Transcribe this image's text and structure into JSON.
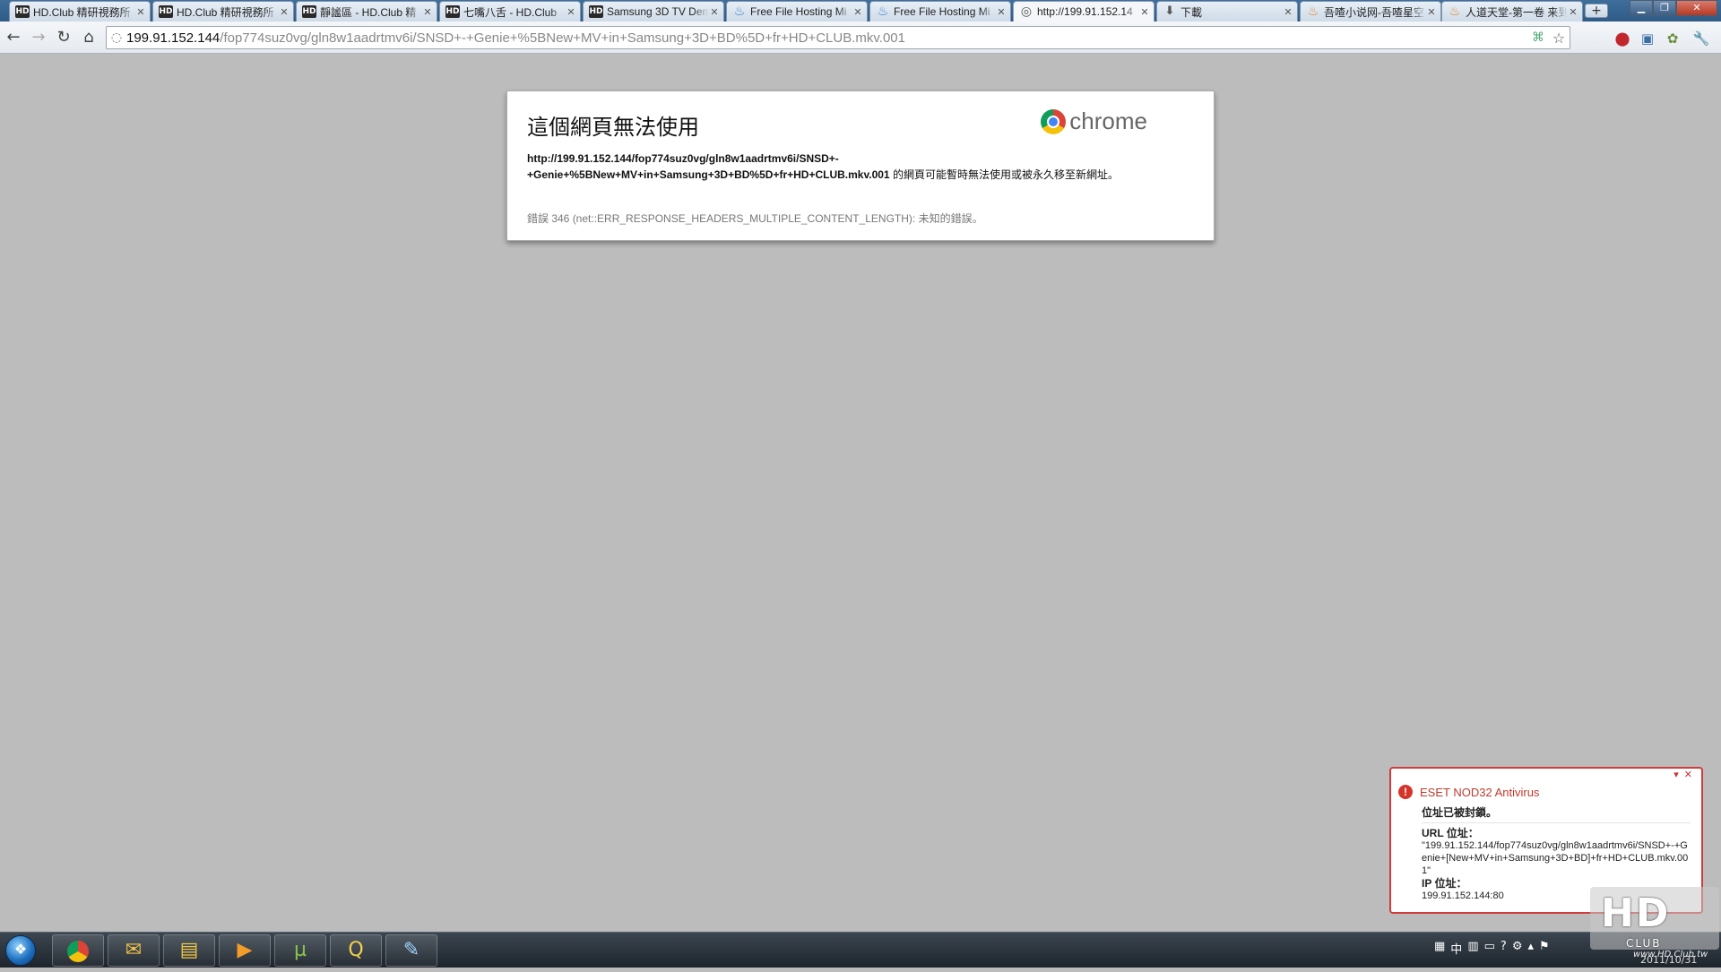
{
  "tabs": [
    {
      "label": "HD.Club 精研視務所",
      "favicon": "hd-club-icon",
      "active": false
    },
    {
      "label": "HD.Club 精研視務所",
      "favicon": "hd-club-icon",
      "active": false
    },
    {
      "label": "靜謐區 - HD.Club 精",
      "favicon": "hd-club-icon",
      "active": false
    },
    {
      "label": "七嘴八舌 - HD.Club",
      "favicon": "hd-club-icon",
      "active": false
    },
    {
      "label": "Samsung 3D TV Dem",
      "favicon": "hd-club-icon",
      "active": false
    },
    {
      "label": "Free File Hosting Mi",
      "favicon": "file-hosting-icon",
      "active": false
    },
    {
      "label": "Free File Hosting Mi",
      "favicon": "file-hosting-icon",
      "active": false
    },
    {
      "label": "http://199.91.152.14",
      "favicon": "globe-icon",
      "active": true
    },
    {
      "label": "下載",
      "favicon": "download-icon",
      "active": false
    },
    {
      "label": "吾喳小说网-吾喳星空",
      "favicon": "novel-site-icon",
      "active": false
    },
    {
      "label": "人道天堂-第一卷 来到",
      "favicon": "novel-site-icon",
      "active": false
    }
  ],
  "address_bar": {
    "host": "199.91.152.144",
    "path": "/fop774suz0vg/gln8w1aadrtmv6i/SNSD+-+Genie+%5BNew+MV+in+Samsung+3D+BD%5D+fr+HD+CLUB.mkv.001"
  },
  "error_page": {
    "title": "這個網頁無法使用",
    "brand": "chrome",
    "url_line1": "http://199.91.152.144/fop774suz0vg/gln8w1aadrtmv6i/SNSD+-",
    "url_line2": "+Genie+%5BNew+MV+in+Samsung+3D+BD%5D+fr+HD+CLUB.mkv.001",
    "message": " 的網頁可能暫時無法使用或被永久移至新網址。",
    "error_detail": "錯誤 346 (net::ERR_RESPONSE_HEADERS_MULTIPLE_CONTENT_LENGTH): 未知的錯誤。"
  },
  "eset_popup": {
    "app_title": "ESET NOD32 Antivirus",
    "blocked_text": "位址已被封鎖。",
    "url_label": "URL 位址：",
    "url_value": "\"199.91.152.144/fop774suz0vg/gln8w1aadrtmv6i/SNSD+-+Genie+[New+MV+in+Samsung+3D+BD]+fr+HD+CLUB.mkv.001\"",
    "ip_label": "IP 位址：",
    "ip_value": "199.91.152.144:80"
  },
  "watermark": {
    "logo_text": "HD",
    "sub_text": "CLUB",
    "site_text": "www.HD.Club.tw"
  },
  "taskbar": {
    "apps": [
      "chrome-icon",
      "mail-icon",
      "file-explorer-icon",
      "media-player-icon",
      "utorrent-icon",
      "quicktime-icon",
      "paint-icon"
    ],
    "ime": "中",
    "clock": "2011/10/31"
  },
  "colors": {
    "page_background": "#bcbcbc",
    "eset_red": "#d33a3a",
    "tabstrip_blue": "#2f5b86"
  }
}
